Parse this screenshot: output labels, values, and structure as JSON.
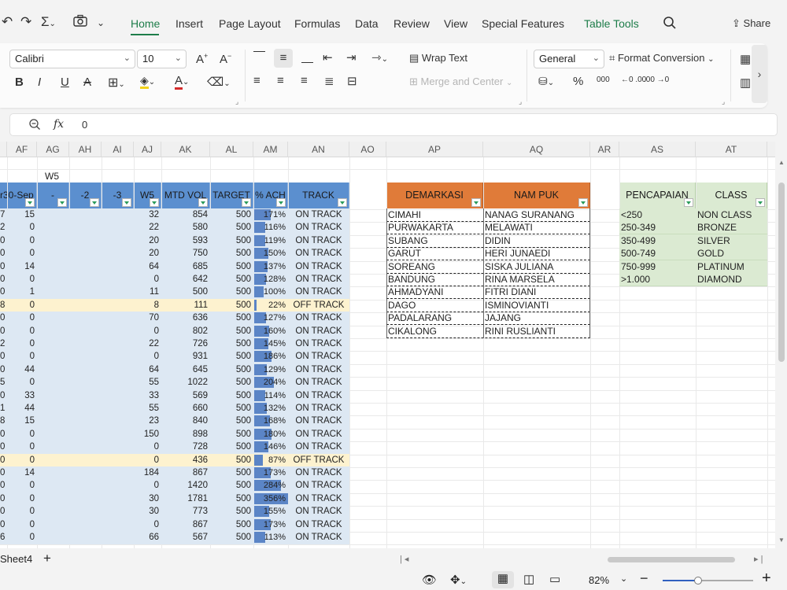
{
  "menubar": {
    "tabs": [
      "Home",
      "Insert",
      "Page Layout",
      "Formulas",
      "Data",
      "Review",
      "View",
      "Special Features",
      "Table Tools"
    ],
    "share_label": "Share"
  },
  "ribbon": {
    "font_name": "Calibri",
    "font_size": "10",
    "wrap_text": "Wrap Text",
    "merge_center": "Merge and Center",
    "number_format": "General",
    "format_conversion": "Format Conversion",
    "percent": "%",
    "thousands": "000",
    "dec_increase": "←0 .00",
    "dec_decrease": ".00 →0"
  },
  "formula_bar": {
    "fx": "fx",
    "value": "0"
  },
  "columns": [
    "AF",
    "AG",
    "AH",
    "AI",
    "AJ",
    "AK",
    "AL",
    "AM",
    "AN",
    "AO",
    "AP",
    "AQ",
    "AR",
    "AS",
    "AT"
  ],
  "labels": {
    "w5_above": "W5"
  },
  "main_table": {
    "headers": [
      "r30-Sep",
      "-",
      "-2",
      "-3",
      "W5",
      "MTD VOL",
      "TARGET",
      "% ACH",
      "TRACK"
    ],
    "rows": [
      {
        "a": "7",
        "af": "15",
        "aj": "32",
        "ak": "854",
        "al": "500",
        "pct": 171,
        "pct_text": "171%",
        "track": "ON TRACK",
        "off": false
      },
      {
        "a": "2",
        "af": "0",
        "aj": "22",
        "ak": "580",
        "al": "500",
        "pct": 116,
        "pct_text": "116%",
        "track": "ON TRACK",
        "off": false
      },
      {
        "a": "0",
        "af": "0",
        "aj": "20",
        "ak": "593",
        "al": "500",
        "pct": 119,
        "pct_text": "119%",
        "track": "ON TRACK",
        "off": false
      },
      {
        "a": "0",
        "af": "0",
        "aj": "20",
        "ak": "750",
        "al": "500",
        "pct": 150,
        "pct_text": "150%",
        "track": "ON TRACK",
        "off": false
      },
      {
        "a": "0",
        "af": "14",
        "aj": "64",
        "ak": "685",
        "al": "500",
        "pct": 137,
        "pct_text": "137%",
        "track": "ON TRACK",
        "off": false
      },
      {
        "a": "0",
        "af": "0",
        "aj": "0",
        "ak": "642",
        "al": "500",
        "pct": 128,
        "pct_text": "128%",
        "track": "ON TRACK",
        "off": false
      },
      {
        "a": "0",
        "af": "1",
        "aj": "11",
        "ak": "500",
        "al": "500",
        "pct": 100,
        "pct_text": "100%",
        "track": "ON TRACK",
        "off": false
      },
      {
        "a": "8",
        "af": "0",
        "aj": "8",
        "ak": "111",
        "al": "500",
        "pct": 22,
        "pct_text": "22%",
        "track": "OFF TRACK",
        "off": true
      },
      {
        "a": "0",
        "af": "0",
        "aj": "70",
        "ak": "636",
        "al": "500",
        "pct": 127,
        "pct_text": "127%",
        "track": "ON TRACK",
        "off": false
      },
      {
        "a": "0",
        "af": "0",
        "aj": "0",
        "ak": "802",
        "al": "500",
        "pct": 160,
        "pct_text": "160%",
        "track": "ON TRACK",
        "off": false
      },
      {
        "a": "2",
        "af": "0",
        "aj": "22",
        "ak": "726",
        "al": "500",
        "pct": 145,
        "pct_text": "145%",
        "track": "ON TRACK",
        "off": false
      },
      {
        "a": "0",
        "af": "0",
        "aj": "0",
        "ak": "931",
        "al": "500",
        "pct": 186,
        "pct_text": "186%",
        "track": "ON TRACK",
        "off": false
      },
      {
        "a": "0",
        "af": "44",
        "aj": "64",
        "ak": "645",
        "al": "500",
        "pct": 129,
        "pct_text": "129%",
        "track": "ON TRACK",
        "off": false
      },
      {
        "a": "5",
        "af": "0",
        "aj": "55",
        "ak": "1022",
        "al": "500",
        "pct": 204,
        "pct_text": "204%",
        "track": "ON TRACK",
        "off": false
      },
      {
        "a": "0",
        "af": "33",
        "aj": "33",
        "ak": "569",
        "al": "500",
        "pct": 114,
        "pct_text": "114%",
        "track": "ON TRACK",
        "off": false
      },
      {
        "a": "1",
        "af": "44",
        "aj": "55",
        "ak": "660",
        "al": "500",
        "pct": 132,
        "pct_text": "132%",
        "track": "ON TRACK",
        "off": false
      },
      {
        "a": "8",
        "af": "15",
        "aj": "23",
        "ak": "840",
        "al": "500",
        "pct": 168,
        "pct_text": "168%",
        "track": "ON TRACK",
        "off": false
      },
      {
        "a": "0",
        "af": "0",
        "aj": "150",
        "ak": "898",
        "al": "500",
        "pct": 180,
        "pct_text": "180%",
        "track": "ON TRACK",
        "off": false
      },
      {
        "a": "0",
        "af": "0",
        "aj": "0",
        "ak": "728",
        "al": "500",
        "pct": 146,
        "pct_text": "146%",
        "track": "ON TRACK",
        "off": false
      },
      {
        "a": "0",
        "af": "0",
        "aj": "0",
        "ak": "436",
        "al": "500",
        "pct": 87,
        "pct_text": "87%",
        "track": "OFF TRACK",
        "off": true
      },
      {
        "a": "0",
        "af": "14",
        "aj": "184",
        "ak": "867",
        "al": "500",
        "pct": 173,
        "pct_text": "173%",
        "track": "ON TRACK",
        "off": false
      },
      {
        "a": "0",
        "af": "0",
        "aj": "0",
        "ak": "1420",
        "al": "500",
        "pct": 284,
        "pct_text": "284%",
        "track": "ON TRACK",
        "off": false
      },
      {
        "a": "0",
        "af": "0",
        "aj": "30",
        "ak": "1781",
        "al": "500",
        "pct": 356,
        "pct_text": "356%",
        "track": "ON TRACK",
        "off": false
      },
      {
        "a": "0",
        "af": "0",
        "aj": "30",
        "ak": "773",
        "al": "500",
        "pct": 155,
        "pct_text": "155%",
        "track": "ON TRACK",
        "off": false
      },
      {
        "a": "0",
        "af": "0",
        "aj": "0",
        "ak": "867",
        "al": "500",
        "pct": 173,
        "pct_text": "173%",
        "track": "ON TRACK",
        "off": false
      },
      {
        "a": "6",
        "af": "0",
        "aj": "66",
        "ak": "567",
        "al": "500",
        "pct": 113,
        "pct_text": "113%",
        "track": "ON TRACK",
        "off": false
      }
    ]
  },
  "demarkasi_table": {
    "headers": [
      "DEMARKASI",
      "NAM PUK"
    ],
    "rows": [
      [
        "CIMAHI",
        "NANAG SURANANG"
      ],
      [
        "PURWAKARTA",
        "MELAWATI"
      ],
      [
        "SUBANG",
        "DIDIN"
      ],
      [
        "GARUT",
        "HERI JUNAEDI"
      ],
      [
        "SOREANG",
        "SISKA JULIANA"
      ],
      [
        "BANDUNG",
        "RINA MARSELA"
      ],
      [
        "AHMADYANI",
        "FITRI DIANI"
      ],
      [
        "DAGO",
        "ISMINOVIANTI"
      ],
      [
        "PADALARANG",
        "JAJANG"
      ],
      [
        "CIKALONG",
        "RINI RUSLIANTI"
      ]
    ]
  },
  "class_table": {
    "headers": [
      "PENCAPAIAN",
      "CLASS"
    ],
    "rows": [
      [
        "<250",
        "NON CLASS"
      ],
      [
        "250-349",
        "BRONZE"
      ],
      [
        "350-499",
        "SILVER"
      ],
      [
        "500-749",
        "GOLD"
      ],
      [
        "750-999",
        "PLATINUM"
      ],
      [
        ">1.000",
        "DIAMOND"
      ]
    ]
  },
  "sheet_tab": "Sheet4",
  "status": {
    "zoom": "82%"
  },
  "colors": {
    "accent": "#1e7d4a",
    "header_blue": "#5b8fcf",
    "bar_blue": "#5b85c6",
    "row_blue": "#dde8f3",
    "row_off": "#fdf2cf",
    "orange": "#e07b39",
    "green": "#dbead2"
  }
}
